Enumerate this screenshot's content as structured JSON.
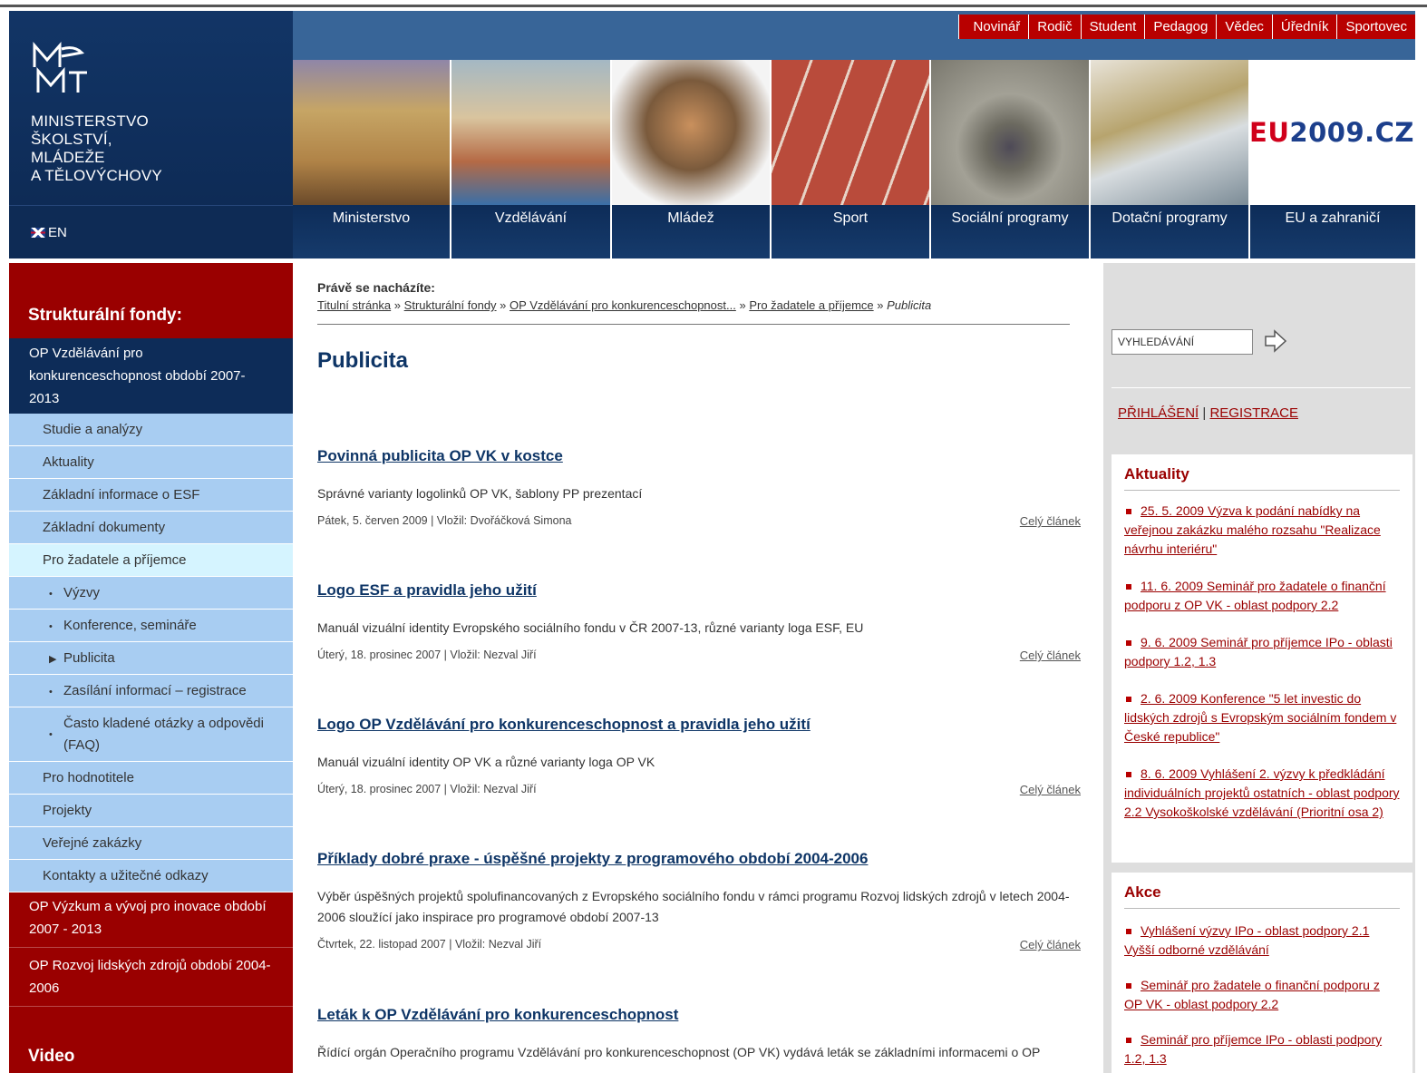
{
  "header": {
    "ministry_name": "MINISTERSTVO\nŠKOLSTVÍ,\nMLÁDEŽE\nA TĚLOVÝCHOVY",
    "lang_label": "EN",
    "audience_nav": [
      "Novinář",
      "Rodič",
      "Student",
      "Pedagog",
      "Vědec",
      "Úředník",
      "Sportovec"
    ],
    "eu_logo_prefix": "EU",
    "eu_logo_suffix": "2009.CZ",
    "section_nav": [
      "Ministerstvo",
      "Vzdělávání",
      "Mládež",
      "Sport",
      "Sociální programy",
      "Dotační programy",
      "EU a zahraničí"
    ]
  },
  "left_sidebar": {
    "title": "Strukturální fondy:",
    "active_program": "OP Vzdělávání pro konkurenceschopnost období 2007-2013",
    "sub_items": [
      {
        "label": "Studie a analýzy"
      },
      {
        "label": "Aktuality"
      },
      {
        "label": "Základní informace o ESF"
      },
      {
        "label": "Základní dokumenty"
      },
      {
        "label": "Pro žadatele a příjemce"
      }
    ],
    "nested_items": [
      {
        "label": "Výzvy",
        "bullet": "•"
      },
      {
        "label": "Konference, semináře",
        "bullet": "•"
      },
      {
        "label": "Publicita",
        "bullet": "▶"
      },
      {
        "label": "Zasílání informací – registrace",
        "bullet": "•"
      },
      {
        "label": "Často kladené otázky a odpovědi (FAQ)",
        "bullet": "•"
      }
    ],
    "more_items": [
      {
        "label": "Pro hodnotitele"
      },
      {
        "label": "Projekty"
      },
      {
        "label": "Veřejné zakázky"
      },
      {
        "label": "Kontakty a užitečné odkazy"
      }
    ],
    "other_programs": [
      "OP Výzkum a vývoj pro inovace období 2007 - 2013",
      "OP Rozvoj lidských zdrojů období 2004-2006"
    ],
    "video_title": "Video"
  },
  "main": {
    "here_label": "Právě se nacházíte:",
    "breadcrumb": {
      "items": [
        "Titulní stránka",
        "Strukturální fondy",
        "OP Vzdělávání pro konkurenceschopnost...",
        "Pro žadatele a příjemce"
      ],
      "separator": "»",
      "current": "Publicita"
    },
    "page_title": "Publicita",
    "more_label": "Celý článek",
    "articles": [
      {
        "title": "Povinná publicita OP VK v kostce",
        "desc": "Správné varianty logolinků OP VK, šablony PP prezentací",
        "meta": "Pátek,  5. červen 2009 | Vložil: Dvořáčková Simona"
      },
      {
        "title": "Logo ESF a pravidla jeho užití",
        "desc": "Manuál vizuální identity Evropského sociálního fondu v ČR 2007-13, různé varianty loga ESF, EU",
        "meta": "Úterý, 18. prosinec 2007 | Vložil: Nezval Jiří"
      },
      {
        "title": "Logo OP Vzdělávání pro konkurenceschopnost a pravidla jeho užití",
        "desc": "Manuál vizuální identity OP VK a různé varianty loga OP VK",
        "meta": "Úterý, 18. prosinec 2007 | Vložil: Nezval Jiří"
      },
      {
        "title": "Příklady dobré praxe - úspěšné projekty z programového období 2004-2006",
        "desc": "Výběr úspěšných projektů spolufinancovaných z Evropského sociálního fondu v rámci programu Rozvoj lidských zdrojů v letech 2004-2006 sloužící jako inspirace pro programové období 2007-13",
        "meta": "Čtvrtek, 22. listopad 2007 | Vložil: Nezval Jiří"
      },
      {
        "title": "Leták k OP Vzdělávání pro konkurenceschopnost",
        "desc": "Řídící orgán Operačního programu Vzdělávání pro konkurenceschopnost (OP VK) vydává leták se základními informacemi o OP",
        "meta": ""
      }
    ]
  },
  "right_sidebar": {
    "search_value": "VYHLEDÁVÁNÍ",
    "login": "PŘIHLÁŠENÍ",
    "auth_sep": "|",
    "register": "REGISTRACE",
    "aktuality_title": "Aktuality",
    "aktuality": [
      "25. 5. 2009 Výzva k podání nabídky na veřejnou zakázku malého rozsahu \"Realizace návrhu interiéru\"",
      "11. 6. 2009 Seminář pro žadatele o finanční podporu z OP VK - oblast podpory 2.2",
      "9. 6. 2009 Seminář pro příjemce IPo - oblasti podpory 1.2, 1.3",
      "2. 6. 2009 Konference \"5 let investic do lidských zdrojů s Evropským sociálním fondem v České republice\"",
      "8. 6. 2009 Vyhlášení 2. výzvy k předkládání individuálních projektů ostatních - oblast podpory 2.2 Vysokoškolské vzdělávání (Prioritní osa 2)"
    ],
    "akce_title": "Akce",
    "akce": [
      "Vyhlášení výzvy IPo - oblast podpory 2.1 Vyšší odborné vzdělávání",
      "Seminář pro žadatele o finanční podporu z OP VK - oblast podpory 2.2",
      "Seminář pro příjemce IPo - oblasti podpory 1.2, 1.3"
    ]
  },
  "colors": {
    "primary_navy": "#0d2c58",
    "header_blue": "#386598",
    "accent_red": "#9a0000",
    "submenu_blue": "#a8cdf2",
    "submenu_active": "#d5f4ff"
  }
}
